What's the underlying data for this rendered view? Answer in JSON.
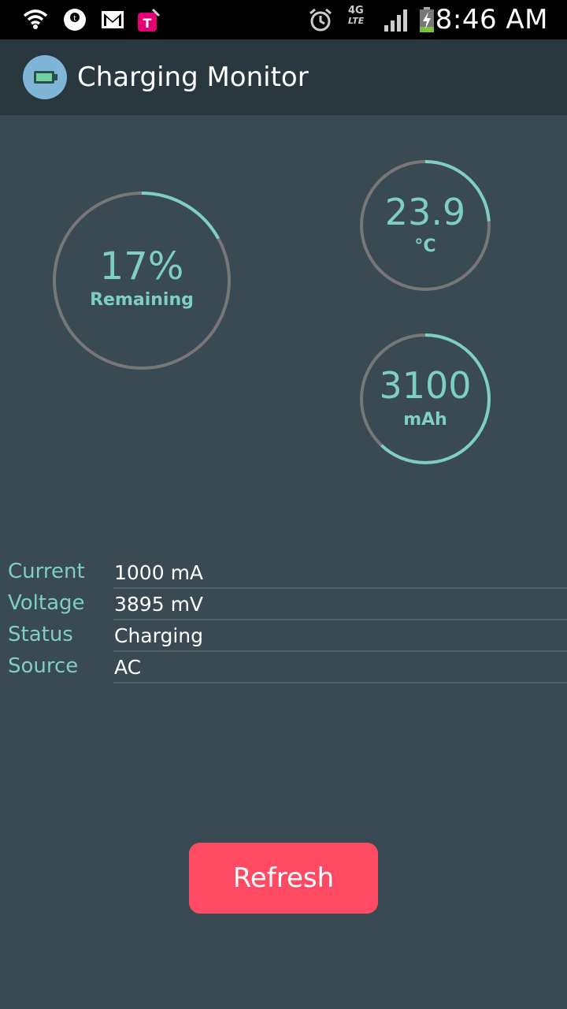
{
  "status_bar": {
    "time": "8:46 AM",
    "network_type_top": "4G",
    "network_type_bottom": "LTE",
    "icons": [
      "wifi-icon",
      "tmobile-tuesdays-icon",
      "gmail-icon",
      "tmobile-icon",
      "alarm-icon",
      "lte-icon",
      "signal-icon",
      "battery-charging-icon"
    ]
  },
  "app": {
    "title": "Charging Monitor",
    "icon": "battery-icon"
  },
  "gauges": {
    "remaining": {
      "value": "17%",
      "unit": "Remaining",
      "fraction": 0.17
    },
    "temperature": {
      "value": "23.9",
      "unit": "°C",
      "fraction": 0.239
    },
    "capacity": {
      "value": "3100",
      "unit": "mAh",
      "fraction": 0.62
    }
  },
  "info": [
    {
      "label": "Current",
      "value": "1000 mA"
    },
    {
      "label": "Voltage",
      "value": "3895 mV"
    },
    {
      "label": "Status",
      "value": "Charging"
    },
    {
      "label": "Source",
      "value": "AC"
    }
  ],
  "button": {
    "label": "Refresh"
  },
  "colors": {
    "background": "#3a4a52",
    "action_bar": "#29373e",
    "accent": "#7ecec4",
    "track": "#777777",
    "button": "#ff4a64"
  }
}
